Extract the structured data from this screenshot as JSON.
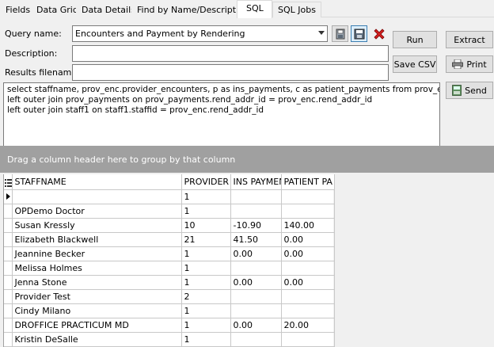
{
  "tabs": [
    {
      "label": "Fields",
      "active": false
    },
    {
      "label": "Data Grid",
      "active": false
    },
    {
      "label": "Data Details",
      "active": false
    },
    {
      "label": "Find by Name/Description",
      "active": false
    },
    {
      "label": "SQL",
      "active": true
    },
    {
      "label": "SQL Jobs",
      "active": false
    }
  ],
  "form": {
    "query_name_label": "Query name:",
    "query_name_value": "Encounters and Payment by Rendering",
    "description_label": "Description:",
    "description_value": "",
    "results_filename_label": "Results filename:",
    "results_filename_value": ""
  },
  "icons": {
    "open": "folder-save-icon",
    "save": "floppy-disk-icon",
    "delete": "red-x-delete-icon",
    "print": "printer-icon",
    "send": "send-mail-icon"
  },
  "buttons": {
    "run": "Run",
    "extract": "Extract",
    "save_csv": "Save CSV",
    "print": "Print",
    "send": "Send"
  },
  "sql_text": "select staffname, prov_enc.provider_encounters, p as ins_payments, c as patient_payments from prov_enc\nleft outer join prov_payments on prov_payments.rend_addr_id = prov_enc.rend_addr_id\nleft outer join staff1 on staff1.staffid = prov_enc.rend_addr_id",
  "group_panel_text": "Drag a column header here to group by that column",
  "grid": {
    "columns": [
      "STAFFNAME",
      "PROVIDER E",
      "INS PAYMEN",
      "PATIENT PA"
    ],
    "rows": [
      [
        "",
        "1",
        "",
        ""
      ],
      [
        "OPDemo Doctor",
        "1",
        "",
        ""
      ],
      [
        "Susan Kressly",
        "10",
        "-10.90",
        "140.00"
      ],
      [
        "Elizabeth Blackwell",
        "21",
        "41.50",
        "0.00"
      ],
      [
        "Jeannine Becker",
        "1",
        "0.00",
        "0.00"
      ],
      [
        "Melissa Holmes",
        "1",
        "",
        ""
      ],
      [
        "Jenna Stone",
        "1",
        "0.00",
        "0.00"
      ],
      [
        "Provider Test",
        "2",
        "",
        ""
      ],
      [
        "Cindy Milano",
        "1",
        "",
        ""
      ],
      [
        "DROFFICE PRACTICUM MD",
        "1",
        "0.00",
        "20.00"
      ],
      [
        "Kristin DeSalle",
        "1",
        "",
        ""
      ]
    ]
  },
  "colors": {
    "group_panel": "#a0a0a0",
    "delete_red": "#d42020",
    "selected_icon_border": "#3c7fb1"
  }
}
